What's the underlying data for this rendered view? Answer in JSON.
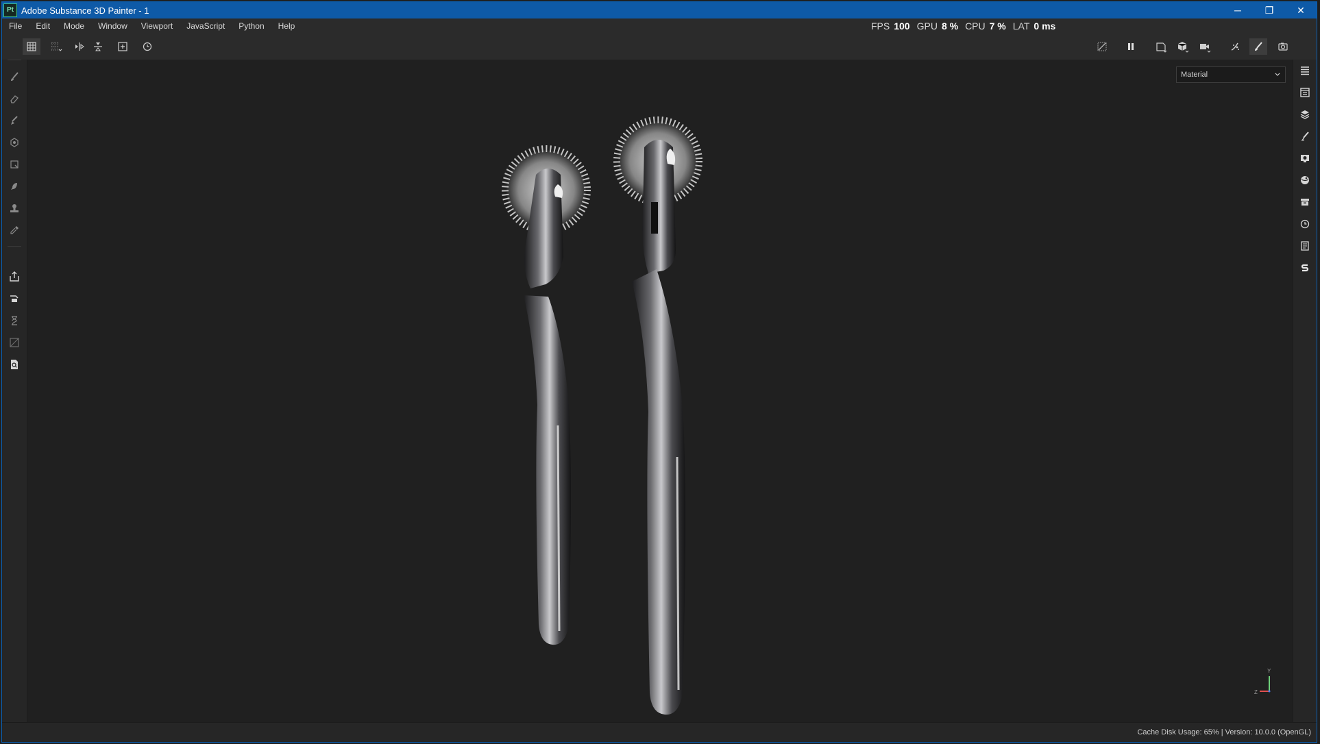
{
  "window": {
    "title": "Adobe Substance 3D Painter - 1",
    "logo_text": "Pt",
    "controls": [
      "─",
      "❐",
      "✕"
    ]
  },
  "menu": [
    "File",
    "Edit",
    "Mode",
    "Window",
    "Viewport",
    "JavaScript",
    "Python",
    "Help"
  ],
  "stats": {
    "fps_label": "FPS",
    "fps_value": "100",
    "gpu_label": "GPU",
    "gpu_value": "8 %",
    "cpu_label": "CPU",
    "cpu_value": "7 %",
    "lat_label": "LAT",
    "lat_value": "0 ms"
  },
  "viewport": {
    "display_mode": "Material",
    "axis_y_label": "Y",
    "axis_z_label": "Z"
  },
  "status": {
    "text": "Cache Disk Usage:   65% | Version: 10.0.0 (OpenGL)"
  },
  "colors": {
    "accent": "#0e5aa7",
    "panel": "#262626",
    "viewport": "#202020"
  }
}
